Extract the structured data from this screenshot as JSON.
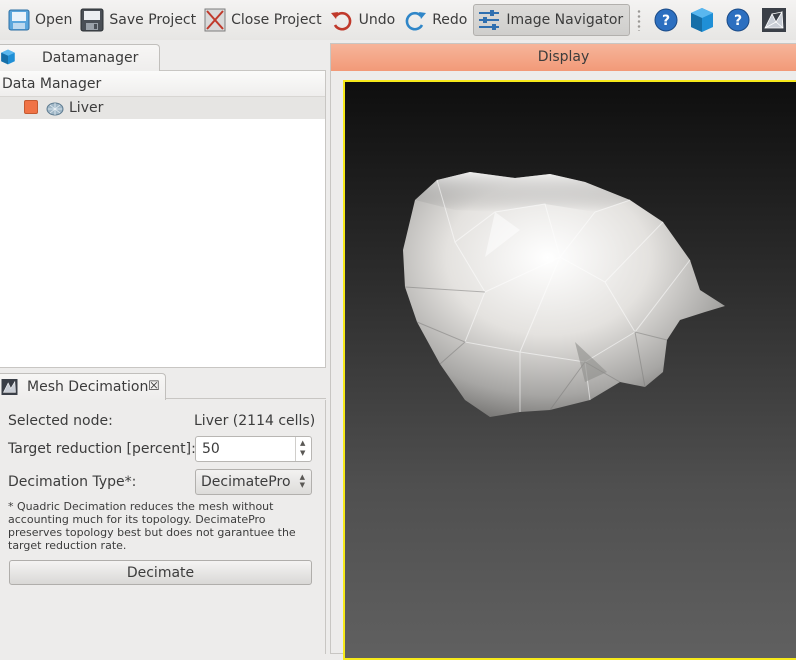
{
  "toolbar": {
    "open": "Open",
    "save_project": "Save Project",
    "close_project": "Close Project",
    "undo": "Undo",
    "redo": "Redo",
    "image_navigator": "Image Navigator"
  },
  "datamanager": {
    "tab_label": "Datamanager",
    "header": "Data Manager",
    "nodes": [
      {
        "name": "Liver",
        "color": "#f07346"
      }
    ]
  },
  "mesh_decimation": {
    "tab_label": "Mesh Decimation",
    "close_glyph": "☒",
    "selected_node_label": "Selected node:",
    "selected_node_value": "Liver (2114 cells)",
    "target_reduction_label": "Target reduction [percent]:",
    "target_reduction_value": "50",
    "decimation_type_label": "Decimation Type*:",
    "decimation_type_value": "DecimatePro",
    "note": "* Quadric Decimation reduces the mesh without accounting much for its topology. DecimatePro preserves topology best but does not garantuee the target reduction rate.",
    "decimate_button": "Decimate"
  },
  "display": {
    "header": "Display",
    "highlight_color": "#f6e91a"
  }
}
